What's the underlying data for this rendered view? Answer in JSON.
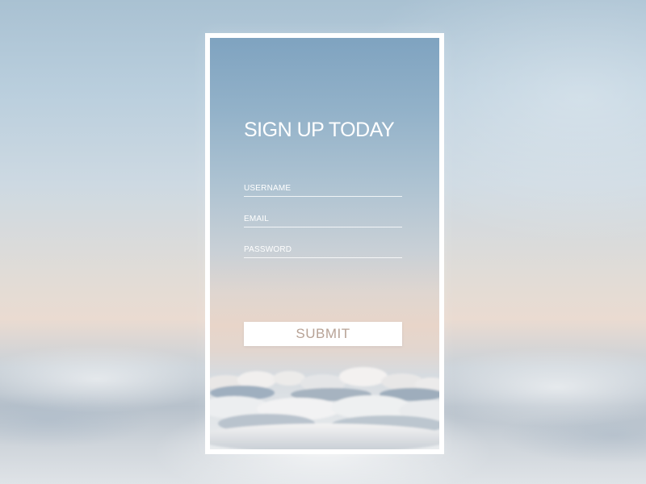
{
  "form": {
    "title": "SIGN UP TODAY",
    "fields": [
      {
        "label": "USERNAME",
        "value": ""
      },
      {
        "label": "EMAIL",
        "value": ""
      },
      {
        "label": "PASSWORD",
        "value": ""
      }
    ],
    "submit_label": "SUBMIT"
  },
  "colors": {
    "frame": "#ffffff",
    "submit_text": "#b7a295",
    "sky_top": "#7fa3c0",
    "sky_horizon": "#e8d5c9"
  }
}
